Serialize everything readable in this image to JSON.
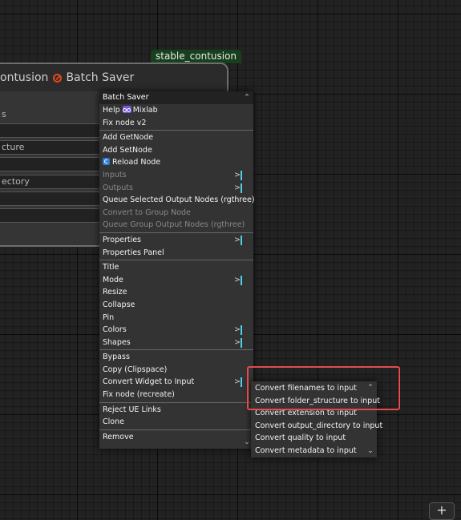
{
  "node": {
    "badge": "stable_contusion",
    "title_prefix": "ontusion",
    "title_name": "Batch Saver",
    "widgets": [
      "s",
      "",
      "cture",
      "",
      "ectory",
      "",
      ""
    ]
  },
  "context_menu": {
    "title": "Batch Saver",
    "items": [
      {
        "label": "Help",
        "extra": "Mixlab",
        "icon": "mixlab-icon"
      },
      {
        "label": "Fix node v2"
      },
      {
        "sep": true
      },
      {
        "label": "Add GetNode"
      },
      {
        "label": "Add SetNode"
      },
      {
        "label": "Reload Node",
        "icon": "reload-icon"
      },
      {
        "label": "Inputs",
        "disabled": true,
        "submenu": true
      },
      {
        "label": "Outputs",
        "disabled": true,
        "submenu": true
      },
      {
        "label": "Queue Selected Output Nodes (rgthree)"
      },
      {
        "label": "Convert to Group Node",
        "disabled": true
      },
      {
        "label": "Queue Group Output Nodes (rgthree)",
        "disabled": true
      },
      {
        "sep": true
      },
      {
        "label": "Properties",
        "submenu": true
      },
      {
        "label": "Properties Panel"
      },
      {
        "sep": true
      },
      {
        "label": "Title"
      },
      {
        "label": "Mode",
        "submenu": true
      },
      {
        "label": "Resize"
      },
      {
        "label": "Collapse"
      },
      {
        "label": "Pin"
      },
      {
        "label": "Colors",
        "submenu": true
      },
      {
        "label": "Shapes",
        "submenu": true
      },
      {
        "sep": true
      },
      {
        "label": "Bypass"
      },
      {
        "label": "Copy (Clipspace)"
      },
      {
        "label": "Convert Widget to Input",
        "submenu": true
      },
      {
        "label": "Fix node (recreate)"
      },
      {
        "sep": true
      },
      {
        "label": "Reject UE Links"
      },
      {
        "label": "Clone"
      },
      {
        "sep": true
      },
      {
        "label": "Remove"
      }
    ]
  },
  "submenu": {
    "items": [
      "Convert filenames to input",
      "Convert folder_structure to input",
      "Convert extension to input",
      "Convert output_directory to input",
      "Convert quality to input",
      "Convert metadata to input"
    ]
  },
  "canvas": {
    "add_button": "+"
  },
  "colors": {
    "accent_marker": "#4fd0e8",
    "highlight": "#e24b4b",
    "badge_bg": "#17401d"
  }
}
